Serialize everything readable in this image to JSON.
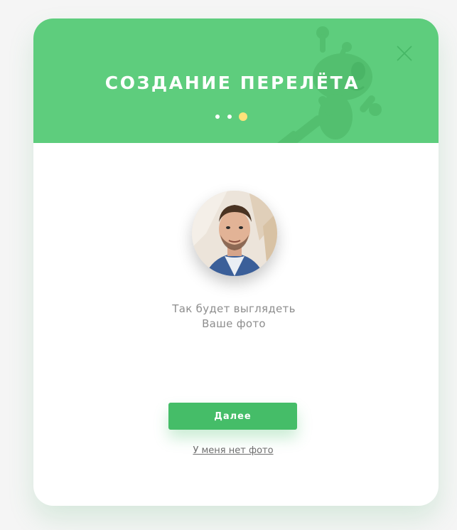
{
  "dialog": {
    "title": "СОЗДАНИЕ ПЕРЕЛЁТА",
    "close_icon": "close-icon",
    "steps": {
      "total": 3,
      "current": 3
    },
    "colors": {
      "header": "#5ecd7d",
      "accent_button": "#45bd68",
      "active_step_dot": "#ffe27a",
      "inactive_step_dot": "#ffffff"
    }
  },
  "preview": {
    "avatar_icon": "user-photo",
    "caption_line1": "Так будет выглядеть",
    "caption_line2": "Ваше фото"
  },
  "actions": {
    "next_label": "Далее",
    "no_photo_label": "У меня нет фото"
  }
}
